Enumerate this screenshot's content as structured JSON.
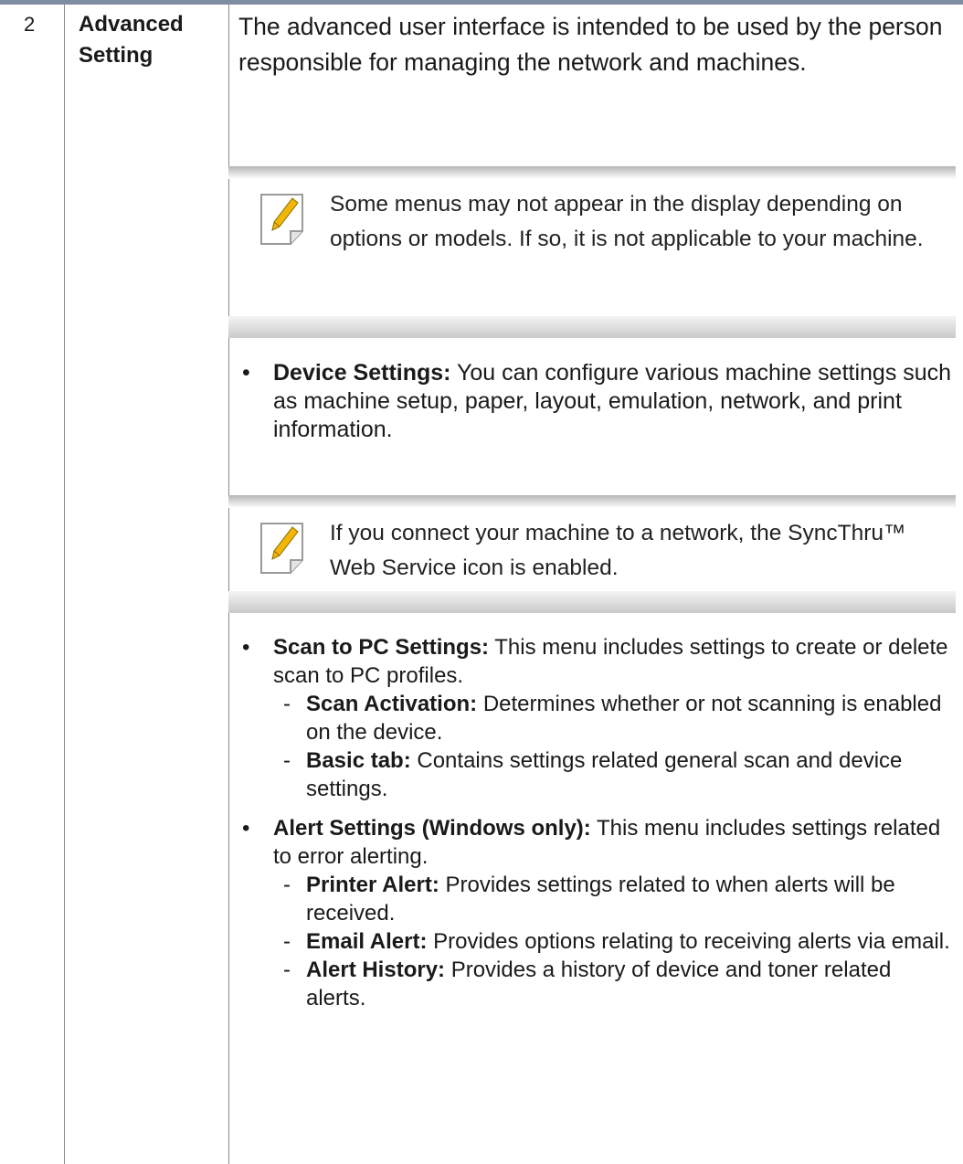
{
  "row_number": "2",
  "setting_label": "Advanced Setting",
  "description": "The advanced user interface is intended to be used by the person responsible for managing the network and machines.",
  "note1": "Some menus may not appear in the display depending on options or models. If so, it is not applicable to your machine.",
  "device_settings": {
    "term": "Device Settings:",
    "text": " You can configure various machine settings such as machine setup, paper, layout, emulation, network, and print information."
  },
  "note2": "If you connect your machine to a network, the SyncThru™ Web Service icon is enabled.",
  "scan_settings": {
    "term": "Scan to PC Settings:",
    "text": " This menu includes settings to create or delete scan to PC profiles.",
    "sub": [
      {
        "term": "Scan Activation:",
        "text": " Determines whether or not scanning is enabled on the device."
      },
      {
        "term": "Basic tab:",
        "text": "  Contains settings related general scan and device settings."
      }
    ]
  },
  "alert_settings": {
    "term": "Alert Settings (Windows only):",
    "text": " This menu includes settings related to error alerting.",
    "sub": [
      {
        "term": "Printer Alert:",
        "text": " Provides settings related to when alerts will be received."
      },
      {
        "term": "Email Alert:",
        "text": " Provides options relating to receiving alerts via email."
      },
      {
        "term": "Alert History:",
        "text": "  Provides a history of device and toner related alerts."
      }
    ]
  },
  "bullet": "•",
  "dash": "-",
  "icons": {
    "note": "note-pencil-icon"
  },
  "colors": {
    "table_top_rule": "#7f8da3",
    "pencil": "#f2b705"
  }
}
